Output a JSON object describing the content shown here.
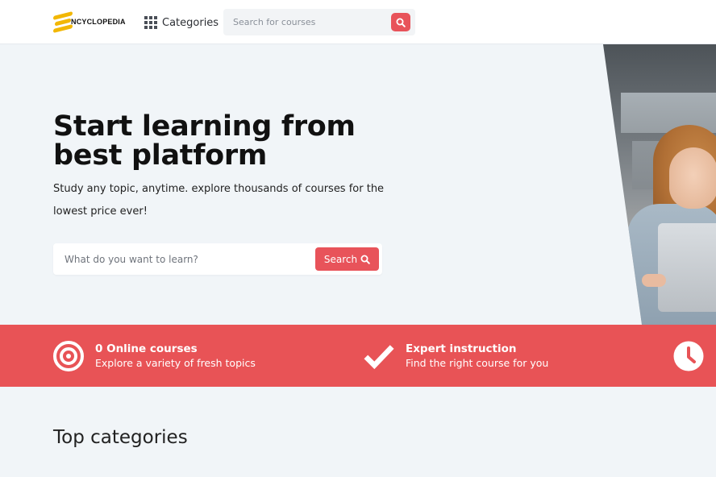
{
  "header": {
    "logo_text": "NCYCLOPEDIA",
    "categories_label": "Categories",
    "search_placeholder": "Search for courses"
  },
  "hero": {
    "title": "Start learning from best platform",
    "subtitle": "Study any topic, anytime. explore thousands of courses for the lowest price ever!",
    "search_placeholder": "What do you want to learn?",
    "search_button_label": "Search"
  },
  "features": [
    {
      "title": "0 Online courses",
      "desc": "Explore a variety of fresh topics",
      "icon": "target-icon"
    },
    {
      "title": "Expert instruction",
      "desc": "Find the right course for you",
      "icon": "checkmark-icon"
    },
    {
      "title": "",
      "desc": "",
      "icon": "clock-icon"
    }
  ],
  "sections": {
    "top_categories_title": "Top categories"
  },
  "colors": {
    "accent": "#e85356",
    "logo_yellow": "#f2b705",
    "page_bg": "#f1f5f8",
    "header_bg": "#ffffff"
  }
}
